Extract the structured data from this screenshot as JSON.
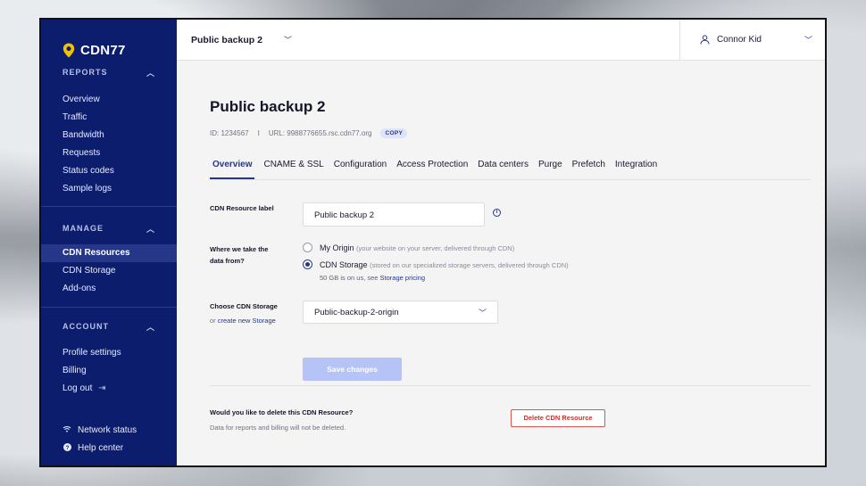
{
  "brand": {
    "name": "CDN77",
    "accent": "#f2c200",
    "nav_bg": "#0c1d6e"
  },
  "sidebar": {
    "reports": {
      "title": "REPORTS",
      "items": [
        {
          "label": "Overview"
        },
        {
          "label": "Traffic"
        },
        {
          "label": "Bandwidth"
        },
        {
          "label": "Requests"
        },
        {
          "label": "Status codes"
        },
        {
          "label": "Sample logs"
        }
      ]
    },
    "manage": {
      "title": "MANAGE",
      "items": [
        {
          "label": "CDN Resources",
          "active": true
        },
        {
          "label": "CDN Storage"
        },
        {
          "label": "Add-ons"
        }
      ]
    },
    "account": {
      "title": "ACCOUNT",
      "items": [
        {
          "label": "Profile settings"
        },
        {
          "label": "Billing"
        },
        {
          "label": "Log out"
        }
      ]
    },
    "footer": {
      "network_status": "Network status",
      "help_center": "Help center"
    }
  },
  "topbar": {
    "resource_name": "Public backup 2",
    "user_name": "Connor Kid"
  },
  "page": {
    "title": "Public backup 2",
    "id_text": "ID: 1234567",
    "separator": "I",
    "url_text": "URL: 9988776655.rsc.cdn77.org",
    "copy_label": "COPY"
  },
  "tabs": [
    {
      "label": "Overview",
      "active": true
    },
    {
      "label": "CNAME & SSL"
    },
    {
      "label": "Configuration"
    },
    {
      "label": "Access Protection"
    },
    {
      "label": "Data centers"
    },
    {
      "label": "Purge"
    },
    {
      "label": "Prefetch"
    },
    {
      "label": "Integration"
    }
  ],
  "form": {
    "label_field": {
      "label": "CDN Resource label",
      "value": "Public backup 2"
    },
    "origin": {
      "label_line1": "Where we take the",
      "label_line2": "data from?",
      "option1": {
        "title": "My Origin",
        "desc": "(your website on your server, delivered through CDN)",
        "selected": false
      },
      "option2": {
        "title": "CDN Storage",
        "desc": "(stored on our specialized storage servers, delivered through CDN)",
        "selected": true
      },
      "note_prefix": "50 GB is on us, see",
      "note_link": "Storage pricing"
    },
    "storage": {
      "label": "Choose CDN Storage",
      "or_text": "or",
      "create_link": "create new Storage",
      "selected": "Public-backup-2-origin"
    },
    "save_label": "Save changes"
  },
  "delete": {
    "question": "Would you like to delete this CDN Resource?",
    "note": "Data for reports and billing will not be deleted.",
    "button": "Delete CDN Resource"
  }
}
